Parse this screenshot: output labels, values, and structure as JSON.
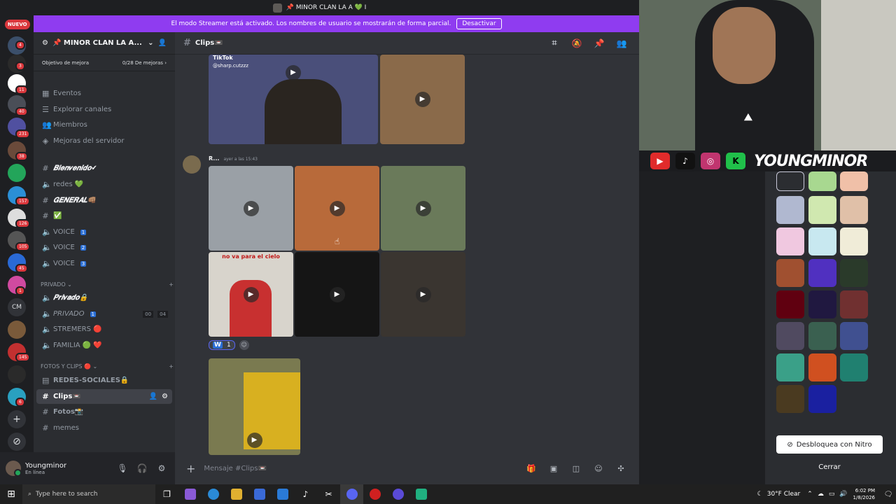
{
  "window": {
    "title": "📌 MINOR CLAN LA A 💚 I"
  },
  "streamer_banner": {
    "text": "El modo Streamer está activado. Los nombres de usuario se mostrarán de forma parcial.",
    "button": "Desactivar"
  },
  "server_rail": {
    "nuevo": "NUEVO",
    "badges": [
      "4",
      "3",
      "11",
      "40",
      "231",
      "38",
      "157",
      "126",
      "105",
      "45",
      "1",
      "145",
      "6"
    ],
    "cm_label": "CM"
  },
  "server": {
    "name": "📌 MINOR CLAN LA A...",
    "boost_goal": "Objetivo de mejora",
    "boost_progress": "0/28 De mejoras",
    "nav": [
      "Eventos",
      "Explorar canales",
      "Miembros",
      "Mejoras del servidor"
    ],
    "channels": [
      {
        "label": "𝑩𝒊𝒆𝒏𝒗𝒆𝒏𝒊𝒅𝒐✔"
      },
      {
        "label": "redes 💚"
      },
      {
        "label": "𝑮𝑬𝑵𝑬𝑹𝑨𝑳👊🏽"
      },
      {
        "label": "✅"
      },
      {
        "label": "VOICE",
        "num": "1"
      },
      {
        "label": "VOICE",
        "num": "2"
      },
      {
        "label": "VOICE",
        "num": "3"
      }
    ],
    "cat_privado": "PRIVADO",
    "privado_channels": [
      {
        "label": "𝑷𝒓𝒊𝒗𝒂𝒅𝒐🔒"
      },
      {
        "label": "PRIVADO",
        "num": "1",
        "count_a": "00",
        "count_b": "04"
      },
      {
        "label": "STREMERS 🔴"
      },
      {
        "label": "FAMILIA 🟢 ❤️"
      }
    ],
    "cat_fotos": "FOTOS Y CLIPS 🔴",
    "fotos_channels": [
      {
        "label": "REDES-SOCIALES🔒"
      },
      {
        "label": "Clips📼"
      },
      {
        "label": "Fotos📸"
      },
      {
        "label": "memes"
      }
    ]
  },
  "user": {
    "name": "Youngminor",
    "status": "En línea"
  },
  "chat": {
    "channel": "Clips📼",
    "tiktok_label": "TikTok",
    "tiktok_user": "@sharp.cutzzz",
    "message_author": "R...",
    "message_time": "ayer a las 15:43",
    "video_caption": "no va para el cielo",
    "reaction_emoji": "W",
    "reaction_count": "1",
    "composer_placeholder": "Mensaje #Clips📼"
  },
  "overlay": {
    "brand": "YOUNGMINOR",
    "nitro_button": "Desbloquea con Nitro",
    "close_button": "Cerrar"
  },
  "taskbar": {
    "search_placeholder": "Type here to search",
    "weather": "30°F  Clear",
    "time": "6:02 PM",
    "date": "1/8/2026"
  }
}
